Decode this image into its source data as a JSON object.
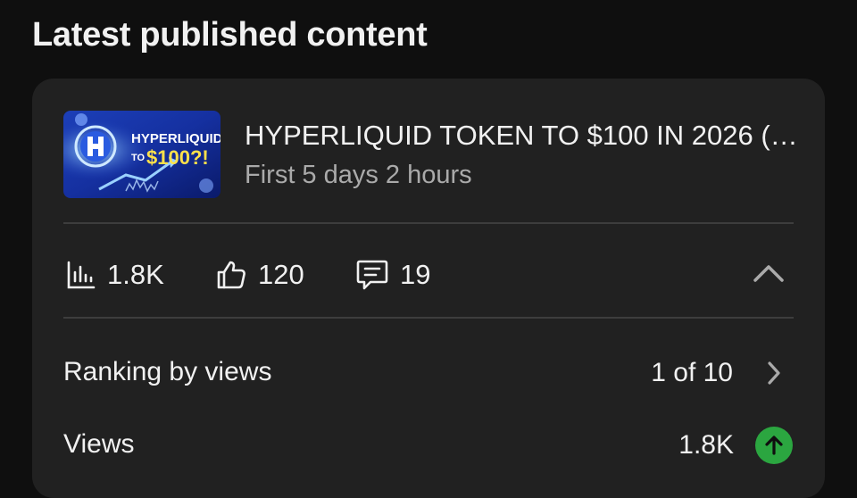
{
  "section": {
    "title": "Latest published content"
  },
  "video": {
    "thumbnail_text": {
      "brand": "HYPERLIQUID",
      "to": "TO",
      "price": "$100?!"
    },
    "title": "HYPERLIQUID TOKEN TO $100 IN 2026 (…",
    "subtitle": "First 5 days 2 hours"
  },
  "stats": {
    "views": {
      "icon": "bar-chart-icon",
      "value": "1.8K"
    },
    "likes": {
      "icon": "thumbs-up-icon",
      "value": "120"
    },
    "comments": {
      "icon": "comment-icon",
      "value": "19"
    }
  },
  "metrics": [
    {
      "label": "Ranking by views",
      "value": "1 of 10",
      "trailing_icon": "chevron-right-icon"
    },
    {
      "label": "Views",
      "value": "1.8K",
      "trailing_icon": "arrow-up-icon"
    }
  ],
  "colors": {
    "background": "#0f0f0f",
    "card": "#212121",
    "accent_up": "#2ba640"
  }
}
